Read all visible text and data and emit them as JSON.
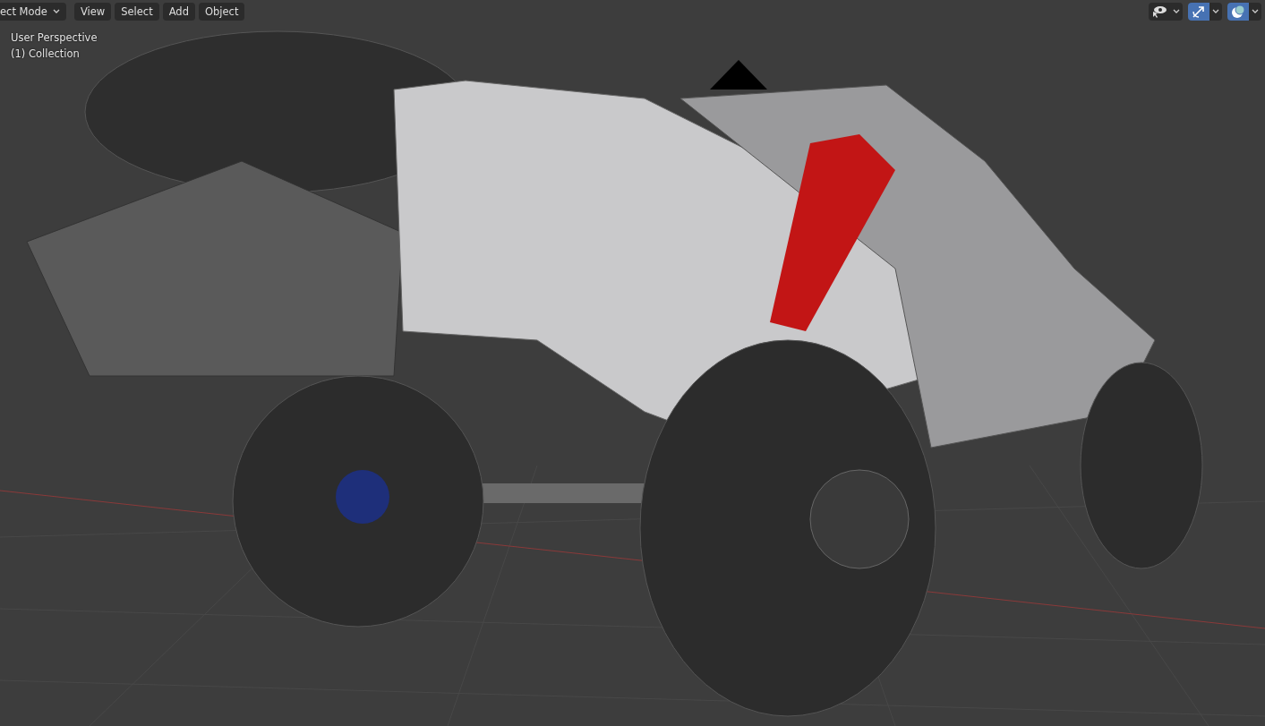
{
  "header": {
    "mode_menu": {
      "label": "ect Mode"
    },
    "menus": [
      {
        "label": "View"
      },
      {
        "label": "Select"
      },
      {
        "label": "Add"
      },
      {
        "label": "Object"
      }
    ],
    "toolbar_toggles": [
      {
        "kind": "visibility",
        "selected": false
      },
      {
        "kind": "gizmo",
        "selected": true
      },
      {
        "kind": "overlay",
        "selected": true
      }
    ]
  },
  "viewport": {
    "info": [
      "User Perspective",
      "(1) Collection"
    ]
  }
}
